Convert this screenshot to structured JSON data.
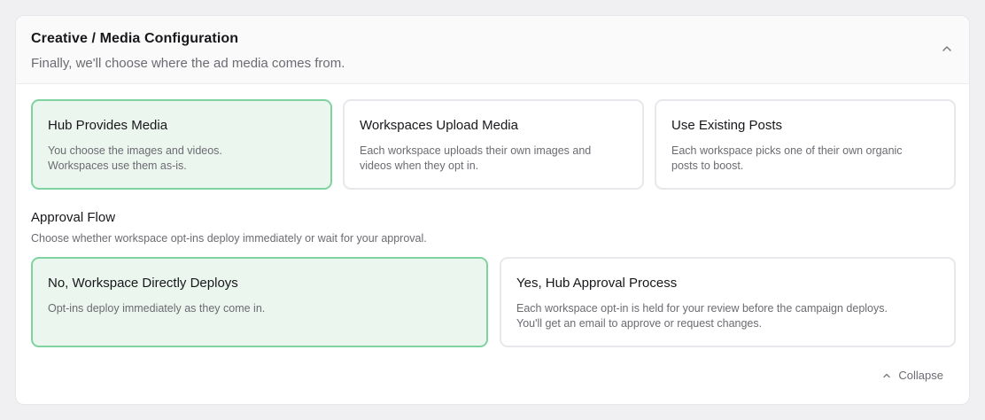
{
  "panel": {
    "title": "Creative / Media Configuration",
    "subtitle": "Finally, we'll choose where the ad media comes from."
  },
  "media_options": [
    {
      "title": "Hub Provides Media",
      "desc_line1": "You choose the images and videos.",
      "desc_line2": "Workspaces use them as-is.",
      "selected": true
    },
    {
      "title": "Workspaces Upload Media",
      "desc_line1": "Each workspace uploads their own images and",
      "desc_line2": "videos when they opt in.",
      "selected": false
    },
    {
      "title": "Use Existing Posts",
      "desc_line1": "Each workspace picks one of their own organic",
      "desc_line2": "posts to boost.",
      "selected": false
    }
  ],
  "approval": {
    "label": "Approval Flow",
    "description": "Choose whether workspace opt-ins deploy immediately or wait for your approval.",
    "options": [
      {
        "title": "No, Workspace Directly Deploys",
        "desc_line1": "Opt-ins deploy immediately as they come in.",
        "desc_line2": "",
        "selected": true
      },
      {
        "title": "Yes, Hub Approval Process",
        "desc_line1": "Each workspace opt-in is held for your review before the campaign deploys.",
        "desc_line2": "You'll get an email to approve or request changes.",
        "selected": false
      }
    ]
  },
  "footer": {
    "collapse_label": "Collapse",
    "collapse_icon": "chevron-up-icon"
  },
  "header_toggle_icon": "chevron-up-icon",
  "colors": {
    "selected_bg": "#ebf6ef",
    "selected_border": "#7fd3a0",
    "card_border": "#e8e8ec",
    "muted_text": "#6b6b72"
  }
}
